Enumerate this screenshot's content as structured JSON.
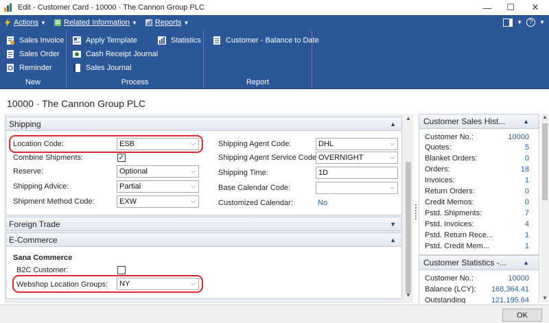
{
  "window": {
    "title": "Edit - Customer Card - 10000 · The Cannon Group PLC",
    "minimize": "—",
    "maximize": "☐",
    "close": "✕"
  },
  "menubar": {
    "actions": "Actions",
    "related_information": "Related Information",
    "reports": "Reports",
    "help": "?"
  },
  "ribbon": {
    "groups": [
      {
        "name": "New",
        "buttons": [
          "Sales Invoice",
          "Sales Order",
          "Reminder"
        ]
      },
      {
        "name": "Process",
        "buttons": [
          "Apply Template",
          "Statistics",
          "Cash Receipt Journal",
          "Sales Journal"
        ]
      },
      {
        "name": "Report",
        "buttons": [
          "Customer - Balance to Date"
        ]
      }
    ]
  },
  "page_title": "10000 · The Cannon Group PLC",
  "shipping": {
    "header": "Shipping",
    "location_code": {
      "label": "Location Code:",
      "value": "ESB"
    },
    "combine_shipments": {
      "label": "Combine Shipments:",
      "checked": "✓"
    },
    "reserve": {
      "label": "Reserve:",
      "value": "Optional"
    },
    "shipping_advice": {
      "label": "Shipping Advice:",
      "value": "Partial"
    },
    "shipment_method_code": {
      "label": "Shipment Method Code:",
      "value": "EXW"
    },
    "shipping_agent_code": {
      "label": "Shipping Agent Code:",
      "value": "DHL"
    },
    "shipping_agent_service_code": {
      "label": "Shipping Agent Service Code:",
      "value": "OVERNIGHT"
    },
    "shipping_time": {
      "label": "Shipping Time:",
      "value": "1D"
    },
    "base_calendar_code": {
      "label": "Base Calendar Code:",
      "value": ""
    },
    "customized_calendar": {
      "label": "Customized Calendar:",
      "value": "No"
    }
  },
  "foreign_trade": {
    "header": "Foreign Trade"
  },
  "ecommerce": {
    "header": "E-Commerce",
    "group": "Sana Commerce",
    "b2c_customer": {
      "label": "B2C Customer:"
    },
    "webshop_location_groups": {
      "label": "Webshop Location Groups:",
      "value": "NY"
    }
  },
  "factbox_sales_history": {
    "header": "Customer Sales Hist...",
    "rows": [
      {
        "k": "Customer No.:",
        "v": "10000"
      },
      {
        "k": "Quotes:",
        "v": "5"
      },
      {
        "k": "Blanket Orders:",
        "v": "0"
      },
      {
        "k": "Orders:",
        "v": "18"
      },
      {
        "k": "Invoices:",
        "v": "1"
      },
      {
        "k": "Return Orders:",
        "v": "0"
      },
      {
        "k": "Credit Memos:",
        "v": "0"
      },
      {
        "k": "Pstd. Shipments:",
        "v": "7"
      },
      {
        "k": "Pstd. Invoices:",
        "v": "4"
      },
      {
        "k": "Pstd. Return Rece...",
        "v": "1"
      },
      {
        "k": "Pstd. Credit Mem...",
        "v": "1"
      }
    ]
  },
  "factbox_statistics": {
    "header": "Customer Statistics -...",
    "rows": [
      {
        "k": "Customer No.:",
        "v": "10000"
      },
      {
        "k": "Balance (LCY):",
        "v": "168,364.41"
      },
      {
        "k": "Outstanding",
        "v": "121,195.64"
      }
    ]
  },
  "ok_label": "OK",
  "colors": {
    "ribbon": "#2b579a",
    "highlight": "#d9262c",
    "link": "#1a5fb4"
  }
}
